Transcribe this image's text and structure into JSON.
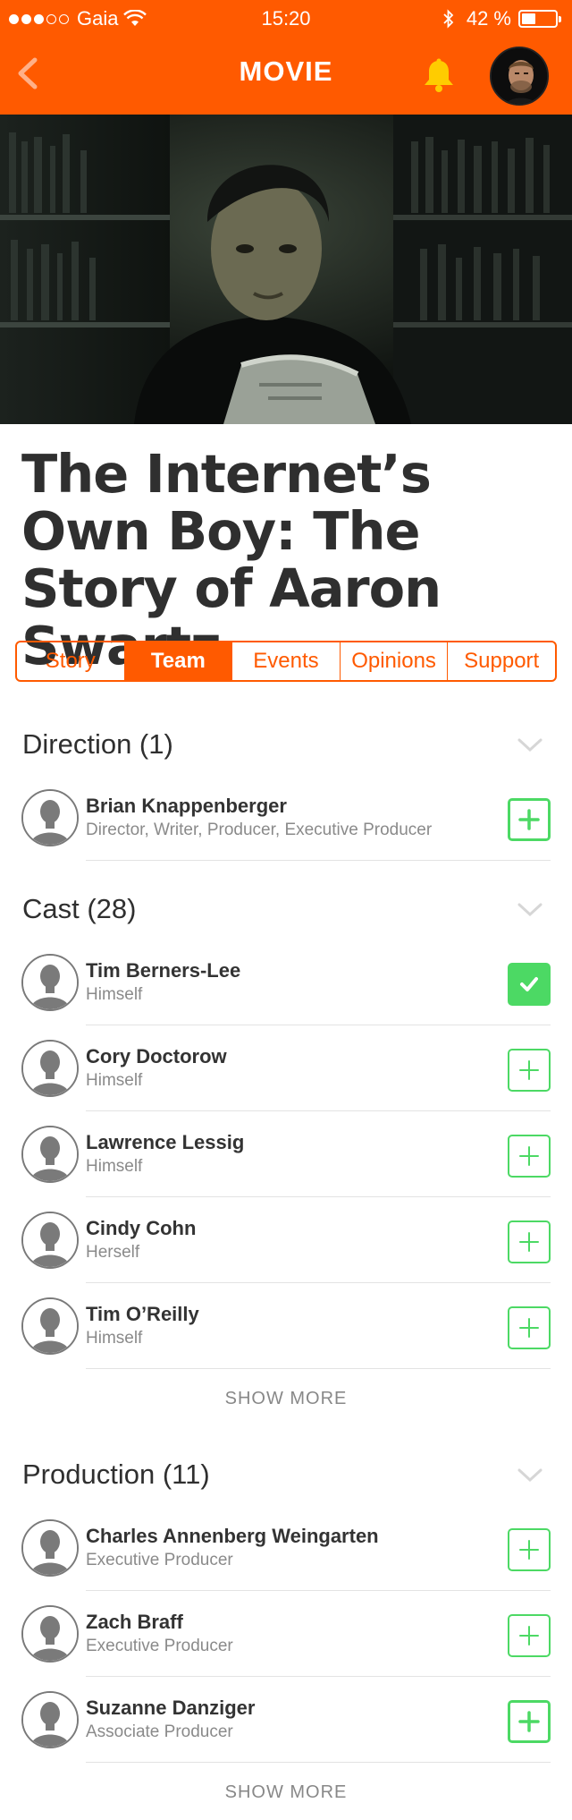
{
  "status_bar": {
    "carrier": "Gaia",
    "time": "15:20",
    "battery": "42 %",
    "battery_level": 0.42
  },
  "nav": {
    "title": "MOVIE",
    "back_icon": "chevron-left-icon",
    "bell_icon": "bell-icon"
  },
  "colors": {
    "brand": "#ff5a00",
    "follow_green": "#4cd964",
    "bell": "#ffcc00"
  },
  "movie": {
    "title": "The Internet’s Own Boy: The Story of Aaron Swartz"
  },
  "tabs": [
    {
      "label": "Story",
      "active": false
    },
    {
      "label": "Team",
      "active": true
    },
    {
      "label": "Events",
      "active": false
    },
    {
      "label": "Opinions",
      "active": false
    },
    {
      "label": "Support",
      "active": false
    }
  ],
  "direction": {
    "heading": "Direction (1)",
    "people": [
      {
        "name": "Brian Knappenberger",
        "role": "Director, Writer, Producer, Executive Producer",
        "followed": false
      }
    ]
  },
  "cast": {
    "heading": "Cast (28)",
    "people": [
      {
        "name": "Tim Berners-Lee",
        "role": "Himself",
        "followed": true
      },
      {
        "name": "Cory Doctorow",
        "role": "Himself",
        "followed": false
      },
      {
        "name": "Lawrence Lessig",
        "role": "Himself",
        "followed": false
      },
      {
        "name": "Cindy Cohn",
        "role": "Herself",
        "followed": false
      },
      {
        "name": "Tim O’Reilly",
        "role": "Himself",
        "followed": false
      }
    ],
    "show_more": "SHOW MORE"
  },
  "production": {
    "heading": "Production (11)",
    "people": [
      {
        "name": "Charles Annenberg Weingarten",
        "role": "Executive Producer",
        "followed": false
      },
      {
        "name": "Zach Braff",
        "role": "Executive Producer",
        "followed": false
      },
      {
        "name": "Suzanne Danziger",
        "role": "Associate Producer",
        "followed": false
      }
    ],
    "show_more": "SHOW MORE"
  }
}
